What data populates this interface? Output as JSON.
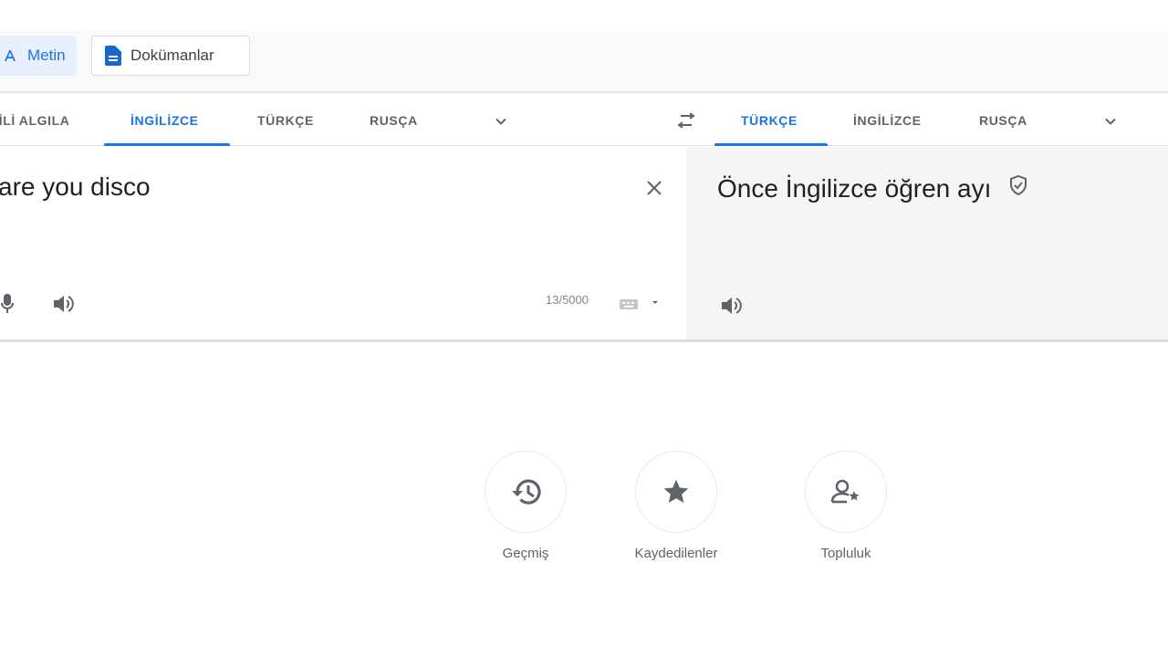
{
  "mode_tabs": {
    "text_label": "Metin",
    "docs_label": "Dokümanlar"
  },
  "source_langs": [
    "DİLİ ALGILA",
    "İNGİLİZCE",
    "TÜRKÇE",
    "RUSÇA"
  ],
  "target_langs": [
    "TÜRKÇE",
    "İNGİLİZCE",
    "RUSÇA"
  ],
  "source": {
    "text": "are you disco",
    "char_count": "13/5000"
  },
  "target": {
    "text": "Önce İngilizce öğren ayı"
  },
  "footer": {
    "history_label": "Geçmiş",
    "saved_label": "Kaydedilenler",
    "community_label": "Topluluk"
  },
  "colors": {
    "accent": "#1a73e8",
    "icon": "#5f6368",
    "target_bg": "#f5f5f5"
  }
}
